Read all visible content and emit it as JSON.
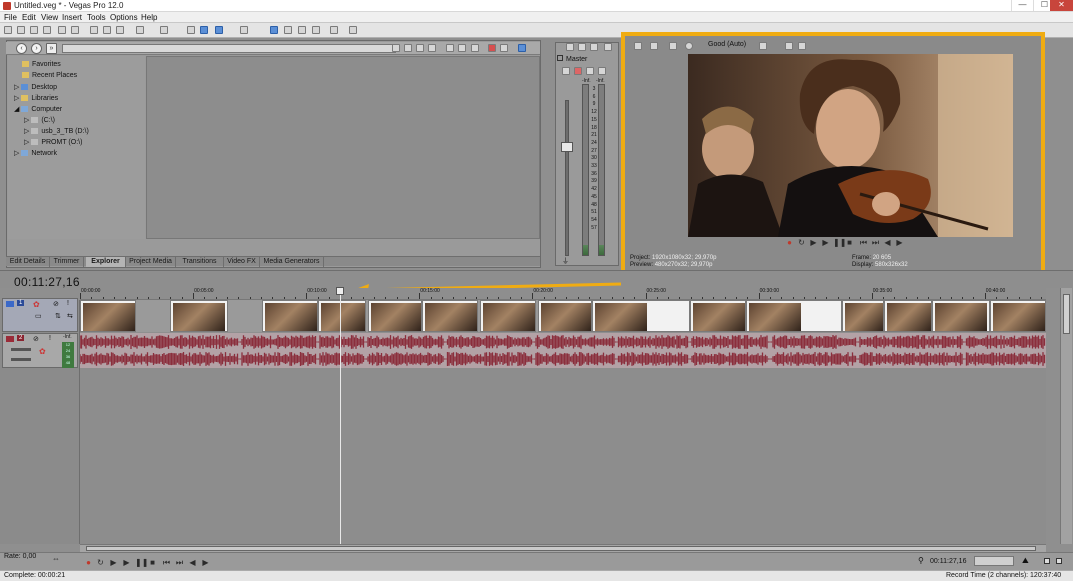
{
  "window": {
    "title": "Untitled.veg * - Vegas Pro 12.0",
    "minimize": "—",
    "maximize": "☐",
    "close": "✕"
  },
  "menu": [
    "File",
    "Edit",
    "View",
    "Insert",
    "Tools",
    "Options",
    "Help"
  ],
  "explorer": {
    "tree": [
      "Favorites",
      "Recent Places",
      "Desktop",
      "Libraries",
      "Computer",
      "(C:\\)",
      "usb_3_TB (D:\\)",
      "PROMT (O:\\)",
      "Network"
    ]
  },
  "tabs": [
    "Edit Details",
    "Trimmer",
    "Explorer",
    "Project Media",
    "Transitions",
    "Video FX",
    "Media Generators"
  ],
  "active_tab": "Explorer",
  "mixer": {
    "title": "Master",
    "db_top_left": "-Inf.",
    "db_top_right": "-Inf.",
    "scale": [
      "3",
      "6",
      "9",
      "12",
      "15",
      "18",
      "21",
      "24",
      "27",
      "30",
      "33",
      "36",
      "39",
      "42",
      "45",
      "48",
      "51",
      "54",
      "57"
    ]
  },
  "preview": {
    "quality": "Good (Auto)",
    "project_label": "Project:",
    "project_value": "1920x1080x32; 29,970p",
    "preview_label": "Preview:",
    "preview_value": "480x270x32; 29,970p",
    "frame_label": "Frame:",
    "frame_value": "20 605",
    "display_label": "Display:",
    "display_value": "580x326x32"
  },
  "timeline": {
    "timecode": "00:11:27,16",
    "ruler": [
      "00:00:00",
      "00:05:00",
      "00:10:00",
      "00:15:00",
      "00:20:00",
      "00:25:00",
      "00:30:00",
      "00:35:00",
      "00:40:00"
    ],
    "video_track_number": "1",
    "audio_track_number": "2",
    "audio_level": "-Inf.",
    "audio_meter_values": [
      "12",
      "24",
      "36",
      "48"
    ]
  },
  "bottom": {
    "rate": "Rate: 0,00",
    "timecode": "00:11:27,16"
  },
  "status": {
    "complete": "Complete: 00:00:21",
    "record_time": "Record Time (2 channels): 120:37:40"
  },
  "colors": {
    "highlight": "#f0ac12",
    "audio_wave": "#8b2e3c",
    "video_track_header": "#a4a8b6"
  }
}
